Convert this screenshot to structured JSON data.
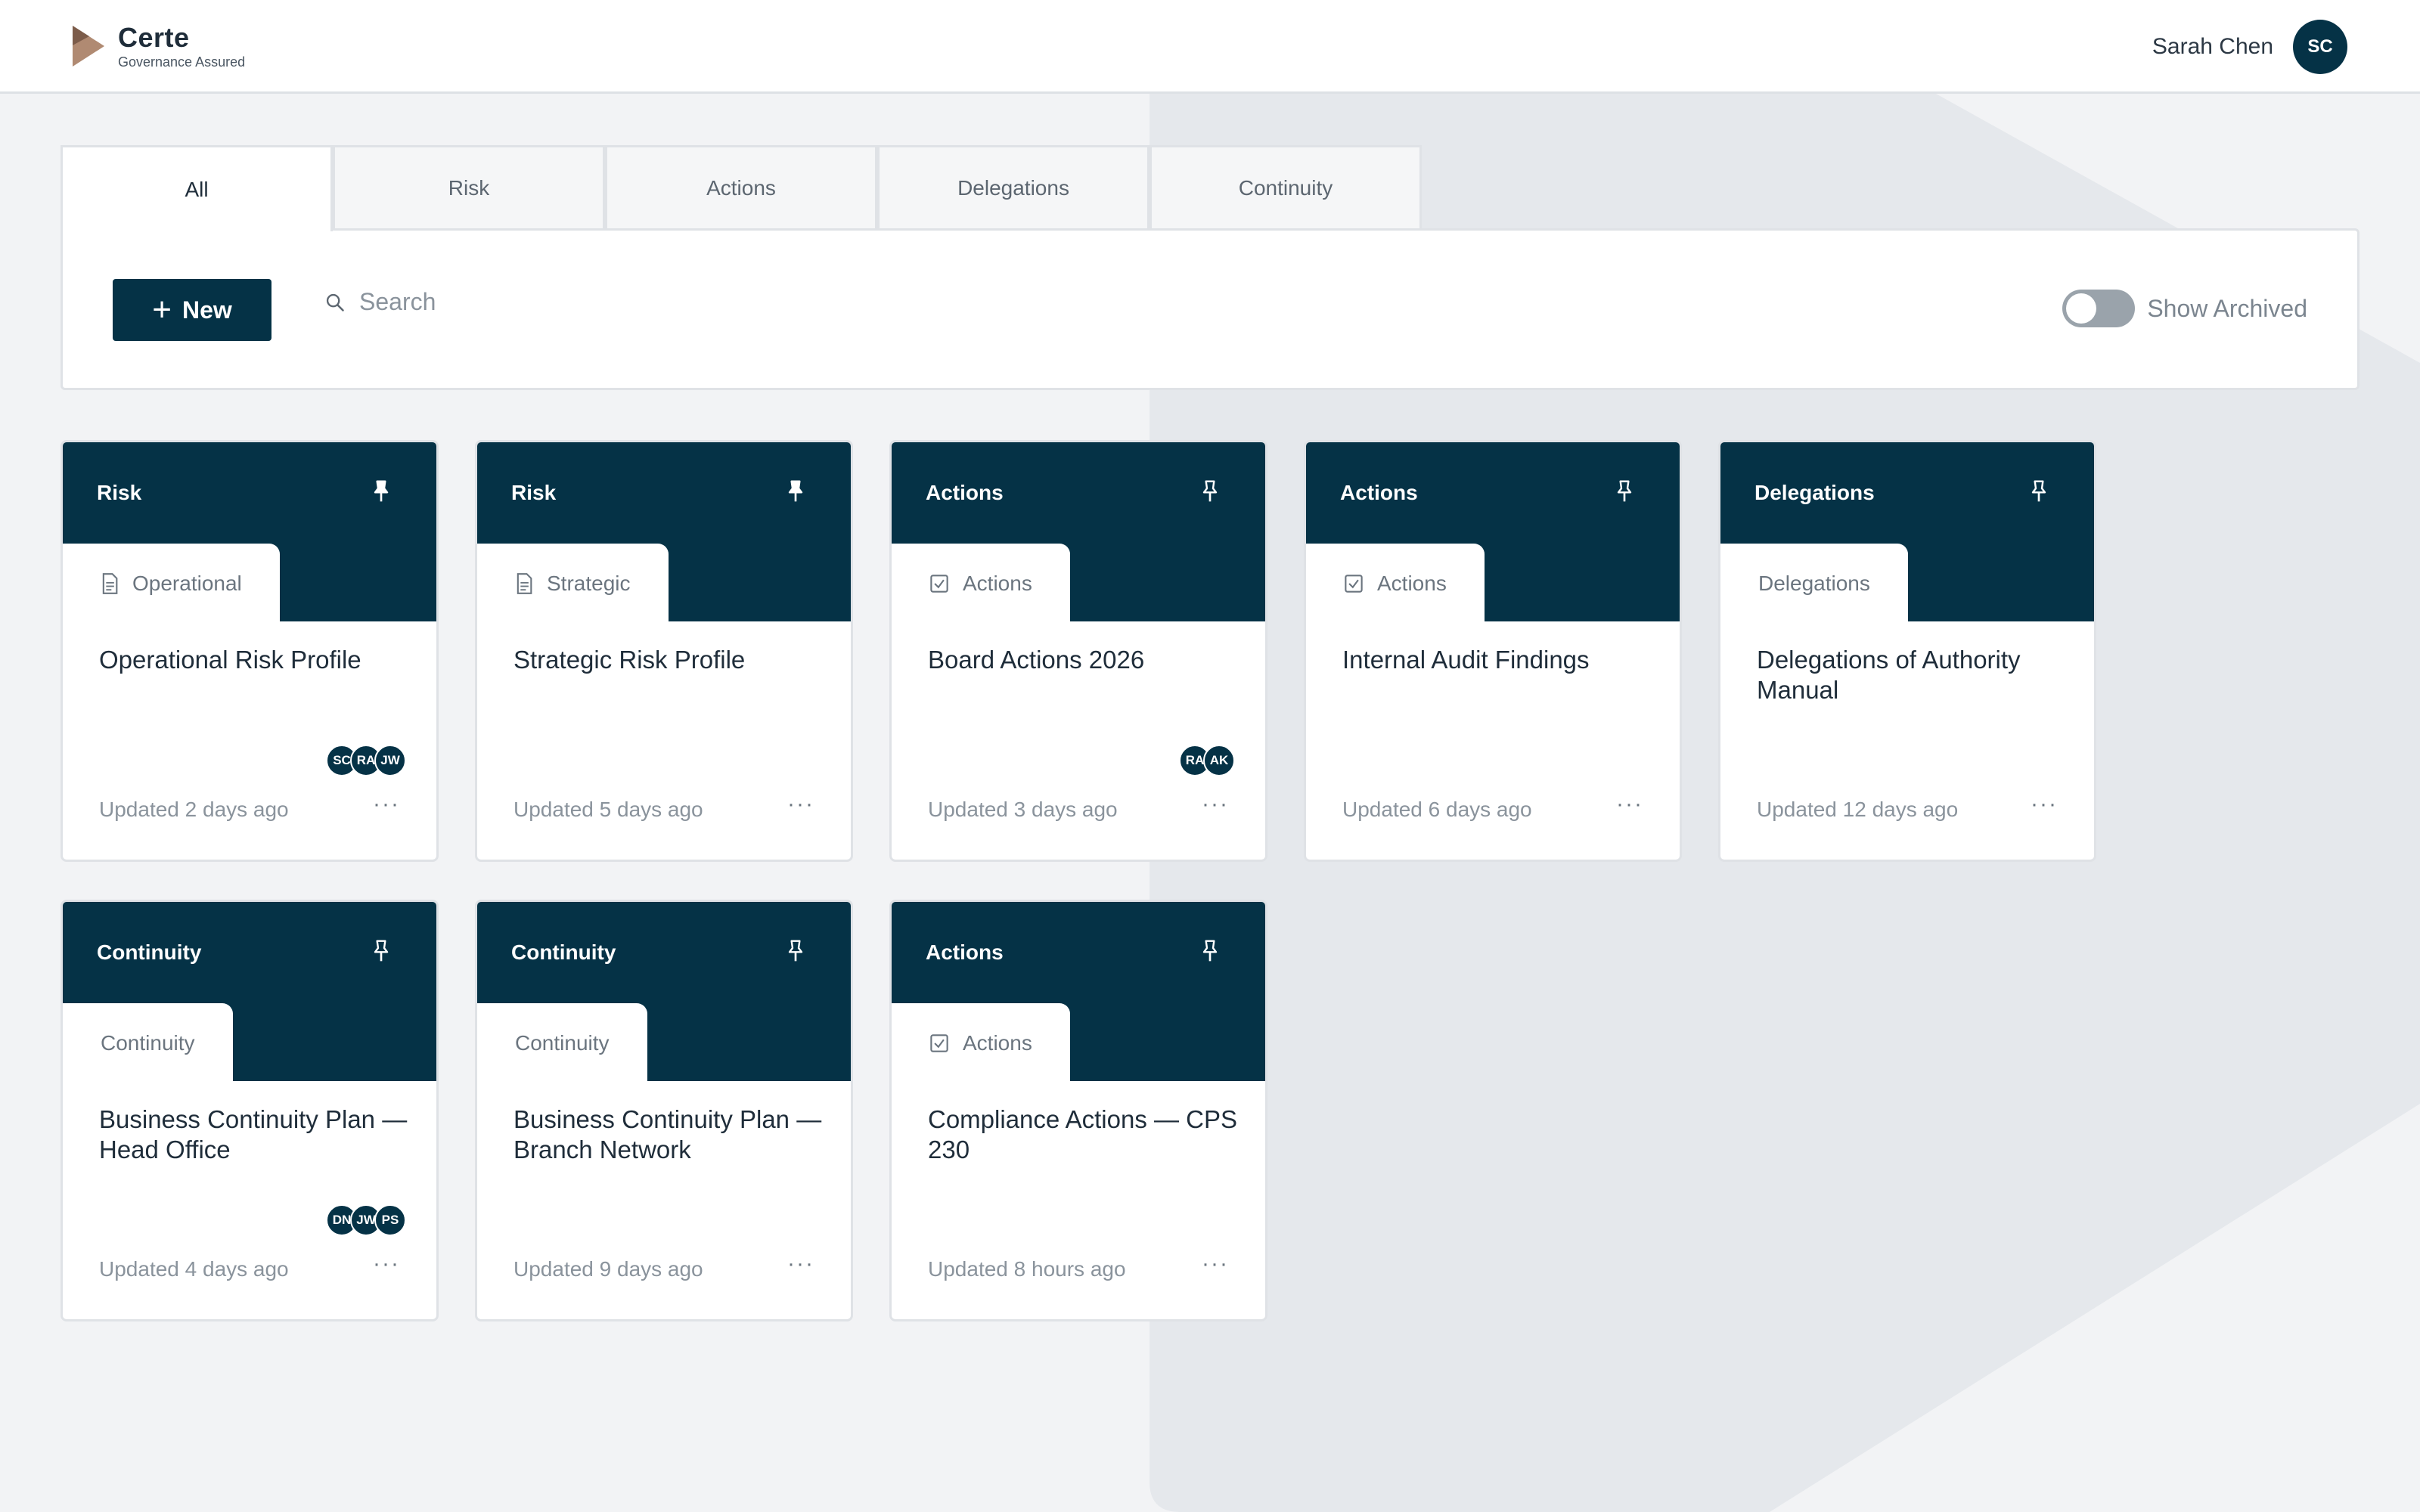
{
  "app": {
    "brand": "Certe",
    "tagline": "Governance Assured",
    "user_name": "Sarah Chen",
    "user_initials": "SC",
    "accent": "#053246"
  },
  "tabs": [
    {
      "label": "All",
      "active": true
    },
    {
      "label": "Risk",
      "active": false
    },
    {
      "label": "Actions",
      "active": false
    },
    {
      "label": "Delegations",
      "active": false
    },
    {
      "label": "Continuity",
      "active": false
    }
  ],
  "toolbar": {
    "new_label": "New",
    "search_placeholder": "Search",
    "archived_label": "Show Archived",
    "archived_on": false
  },
  "cards": [
    {
      "category": "Risk",
      "pinned": true,
      "subtab": "Operational",
      "subtab_icon": "document-icon",
      "title": "Operational Risk Profile",
      "people": [
        "SC",
        "RA",
        "JW"
      ],
      "updated": "Updated 2 days ago"
    },
    {
      "category": "Risk",
      "pinned": true,
      "subtab": "Strategic",
      "subtab_icon": "document-icon",
      "title": "Strategic Risk Profile",
      "people": [],
      "updated": "Updated 5 days ago"
    },
    {
      "category": "Actions",
      "pinned": false,
      "subtab": "Actions",
      "subtab_icon": "checkbox-icon",
      "title": "Board Actions 2026",
      "people": [
        "RA",
        "AK"
      ],
      "updated": "Updated 3 days ago"
    },
    {
      "category": "Actions",
      "pinned": false,
      "subtab": "Actions",
      "subtab_icon": "checkbox-icon",
      "title": "Internal Audit Findings",
      "people": [],
      "updated": "Updated 6 days ago"
    },
    {
      "category": "Delegations",
      "pinned": false,
      "subtab": "Delegations",
      "subtab_icon": "",
      "title": "Delegations of Authority Manual",
      "people": [],
      "updated": "Updated 12 days ago"
    },
    {
      "category": "Continuity",
      "pinned": false,
      "subtab": "Continuity",
      "subtab_icon": "",
      "title": "Business Continuity Plan — Head Office",
      "people": [
        "DN",
        "JW",
        "PS"
      ],
      "updated": "Updated 4 days ago"
    },
    {
      "category": "Continuity",
      "pinned": false,
      "subtab": "Continuity",
      "subtab_icon": "",
      "title": "Business Continuity Plan — Branch Network",
      "people": [],
      "updated": "Updated 9 days ago"
    },
    {
      "category": "Actions",
      "pinned": false,
      "subtab": "Actions",
      "subtab_icon": "checkbox-icon",
      "title": "Compliance Actions — CPS 230",
      "people": [],
      "updated": "Updated 8 hours ago"
    }
  ],
  "more_glyph": "···"
}
